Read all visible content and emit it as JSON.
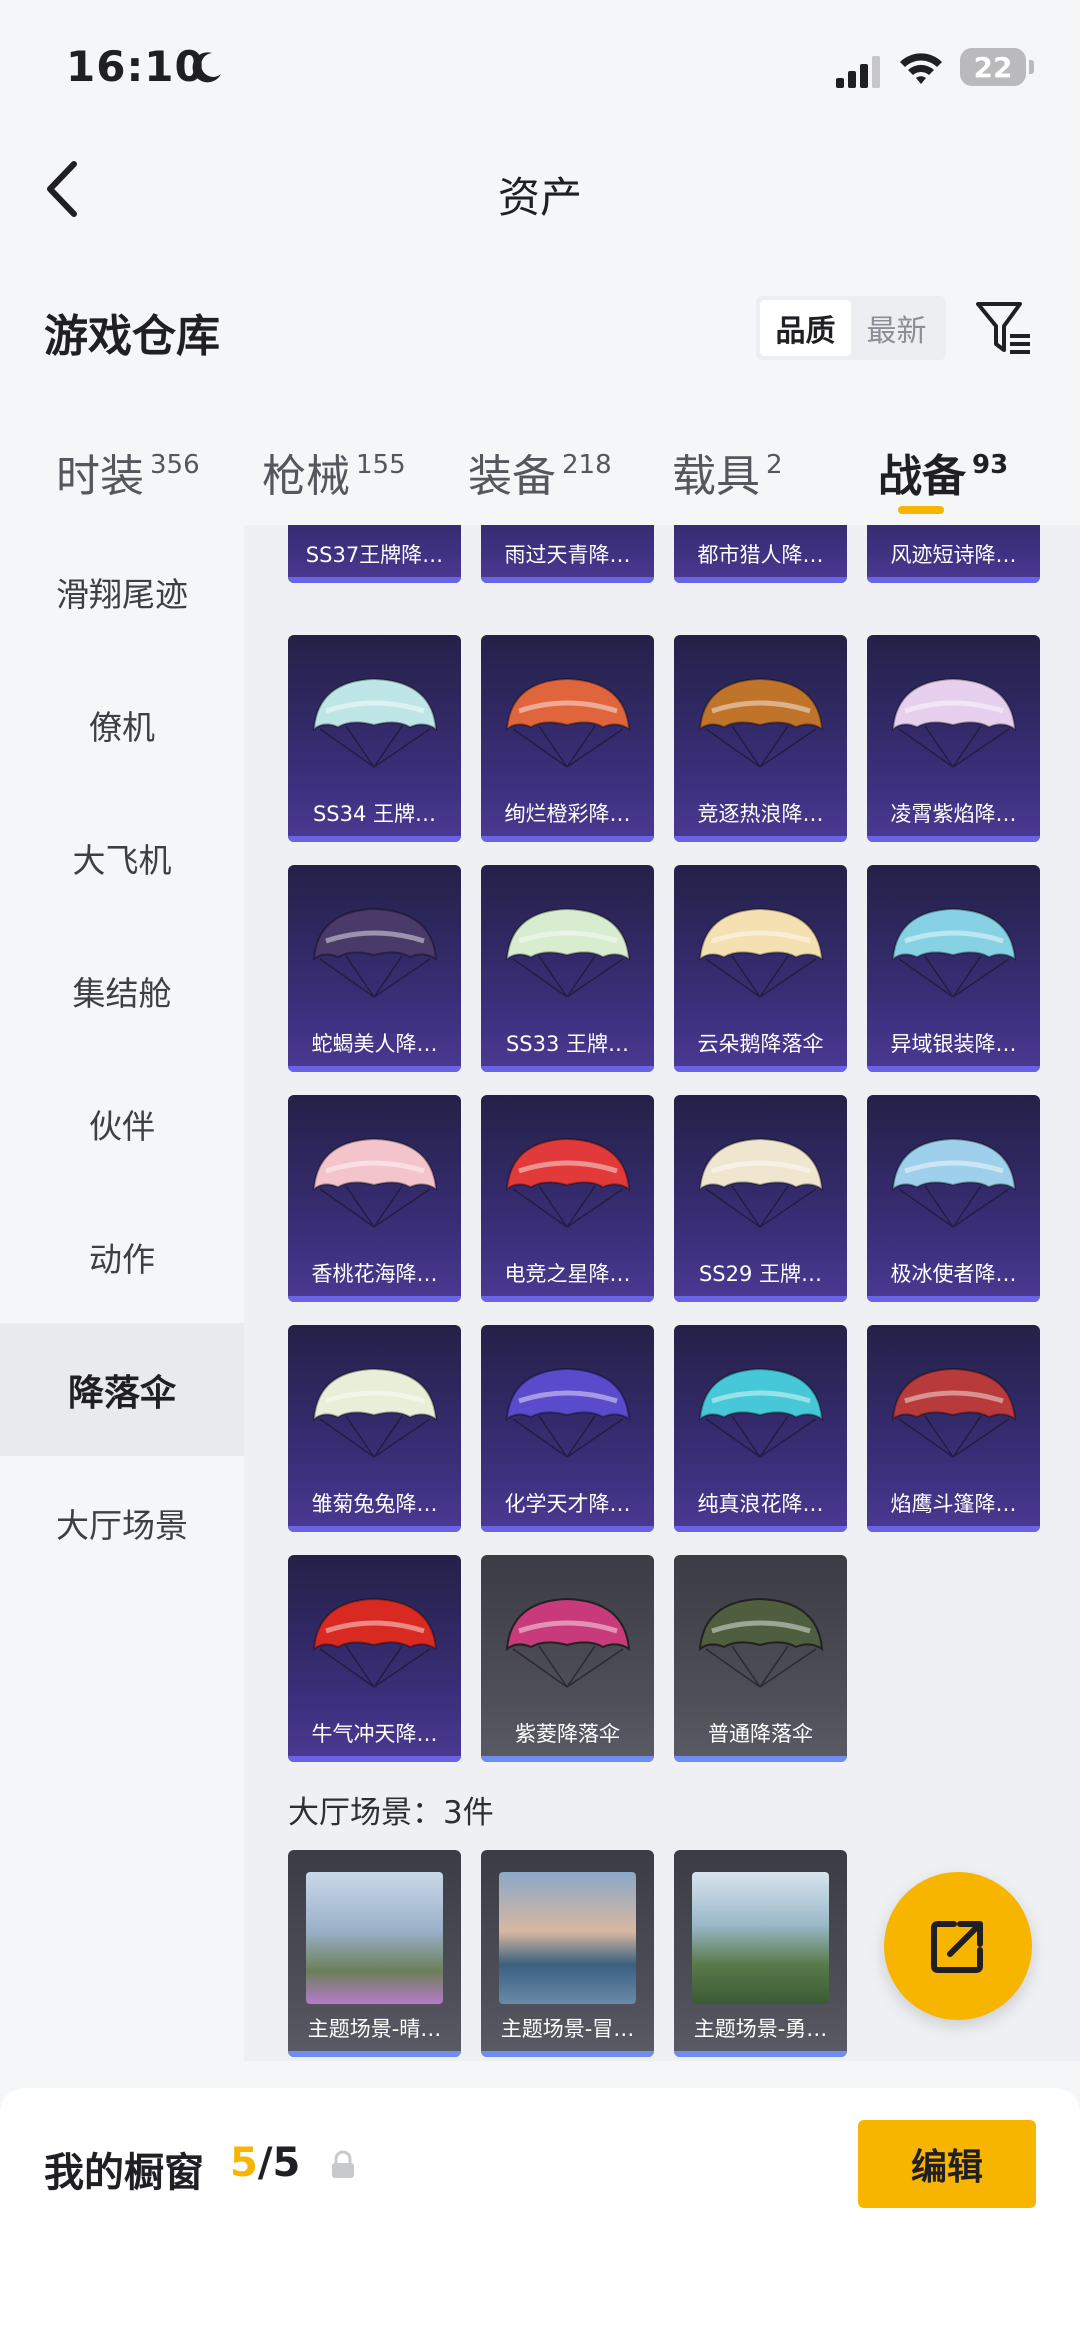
{
  "status": {
    "time": "16:10",
    "battery": "22"
  },
  "nav": {
    "title": "资产"
  },
  "warehouse": {
    "title": "游戏仓库",
    "sort": {
      "quality": "品质",
      "latest": "最新"
    }
  },
  "tabs": [
    {
      "label": "时装",
      "count": "356"
    },
    {
      "label": "枪械",
      "count": "155"
    },
    {
      "label": "装备",
      "count": "218"
    },
    {
      "label": "载具",
      "count": "2"
    },
    {
      "label": "战备",
      "count": "93",
      "active": true
    }
  ],
  "sidebar": [
    {
      "label": "滑翔尾迹"
    },
    {
      "label": "僚机"
    },
    {
      "label": "大飞机"
    },
    {
      "label": "集结舱"
    },
    {
      "label": "伙伴"
    },
    {
      "label": "动作"
    },
    {
      "label": "降落伞",
      "active": true
    },
    {
      "label": "大厅场景"
    }
  ],
  "parachutes": [
    {
      "label": "SS37王牌降…",
      "color": "#7ec8c8"
    },
    {
      "label": "雨过天青降…",
      "color": "#a8d8d0"
    },
    {
      "label": "都市猎人降…",
      "color": "#6a7a80"
    },
    {
      "label": "风迹短诗降…",
      "color": "#e8c26a"
    },
    {
      "label": "SS34 王牌…",
      "color": "#bfe6e6"
    },
    {
      "label": "绚烂橙彩降…",
      "color": "#e0643c"
    },
    {
      "label": "竞逐热浪降…",
      "color": "#c0742a"
    },
    {
      "label": "凌霄紫焰降…",
      "color": "#e6d0ee"
    },
    {
      "label": "蛇蝎美人降…",
      "color": "#4a3a6a"
    },
    {
      "label": "SS33 王牌…",
      "color": "#d8ecd0"
    },
    {
      "label": "云朵鹅降落伞",
      "color": "#f4e0b0"
    },
    {
      "label": "异域银装降…",
      "color": "#86d2e4"
    },
    {
      "label": "香桃花海降…",
      "color": "#f4c4cc"
    },
    {
      "label": "电竞之星降…",
      "color": "#e23a3a"
    },
    {
      "label": "SS29 王牌…",
      "color": "#f0e6d0"
    },
    {
      "label": "极冰使者降…",
      "color": "#9ed0ec"
    },
    {
      "label": "雏菊兔兔降…",
      "color": "#e8eed8"
    },
    {
      "label": "化学天才降…",
      "color": "#5a4acc"
    },
    {
      "label": "纯真浪花降…",
      "color": "#46c8d8"
    },
    {
      "label": "焰鹰斗篷降…",
      "color": "#b83a3a"
    },
    {
      "label": "牛气冲天降…",
      "color": "#d82a20"
    },
    {
      "label": "紫菱降落伞",
      "color": "#c83a7a",
      "grey": true
    },
    {
      "label": "普通降落伞",
      "color": "#4e5e3e",
      "grey": true
    }
  ],
  "lobby": {
    "title": "大厅场景：3件",
    "items": [
      {
        "label": "主题场景-晴…"
      },
      {
        "label": "主题场景-冒…"
      },
      {
        "label": "主题场景-勇…"
      }
    ]
  },
  "showcase": {
    "title": "我的橱窗",
    "current": "5",
    "sep_total": "/5",
    "edit": "编辑"
  }
}
